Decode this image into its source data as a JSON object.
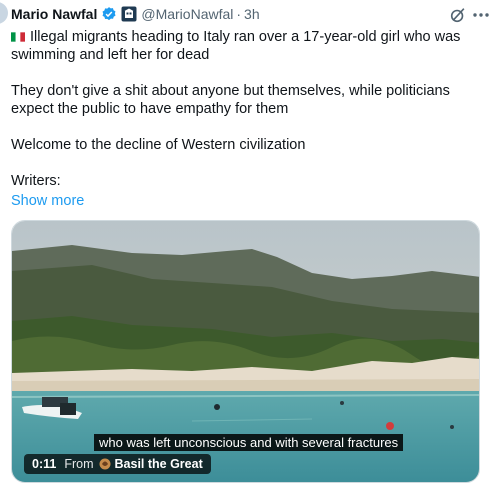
{
  "author": {
    "name": "Mario Nawfal",
    "handle": "@MarioNawfal",
    "separator": "·",
    "time": "3h"
  },
  "tweet": {
    "line1_text": "Illegal migrants heading to Italy ran over a 17-year-old girl who was swimming and left her for dead",
    "line2_text": "They don't give a shit about anyone but themselves, while politicians expect the public to have empathy for them",
    "line3_text": "Welcome to the decline of Western civilization",
    "line4_text": "Writers:",
    "show_more": "Show more"
  },
  "video": {
    "subtitle": "who was left unconscious and with several fractures",
    "timestamp": "0:11",
    "from_label": "From",
    "source": "Basil the Great"
  },
  "icons": {
    "verified": "verified-badge-icon",
    "affiliation": "affiliate-badge-icon",
    "grok": "grok-icon",
    "more": "more-icon",
    "flag": "italy-flag-icon"
  },
  "colors": {
    "accent": "#1d9bf0",
    "secondary_text": "#536471"
  }
}
